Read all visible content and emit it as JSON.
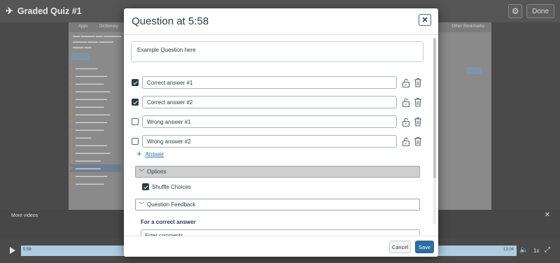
{
  "app": {
    "title": "Graded Quiz #1",
    "done_label": "Done"
  },
  "video_frame": {
    "apps": "Apps",
    "dictionary": "Dictionary",
    "other_bookmarks": "Other Bookmarks"
  },
  "more_videos": {
    "label": "More videos",
    "close": "✕"
  },
  "controls": {
    "current_time": "5:58",
    "total_time": "13:04",
    "speed": "1x"
  },
  "modal": {
    "title": "Question at 5:58",
    "close": "✕",
    "question": "Example Question here",
    "answers": [
      {
        "text": "Correct answer #1",
        "checked": true
      },
      {
        "text": "Correct answer #2",
        "checked": true
      },
      {
        "text": "Wrong answer #1",
        "checked": false
      },
      {
        "text": "Wrong answer #2",
        "checked": false
      }
    ],
    "add_answer_label": "Answer",
    "options_label": "Options",
    "shuffle_label": "Shuffle Choices",
    "shuffle_checked": true,
    "feedback_label": "Question Feedback",
    "correct_answer_label": "For a correct answer",
    "comments_placeholder": "Enter comments...",
    "cancel_label": "Cancel",
    "save_label": "Save"
  },
  "colors": {
    "accent": "#2b6fa3",
    "text": "#2d3b45",
    "progress": "#aecde0"
  }
}
